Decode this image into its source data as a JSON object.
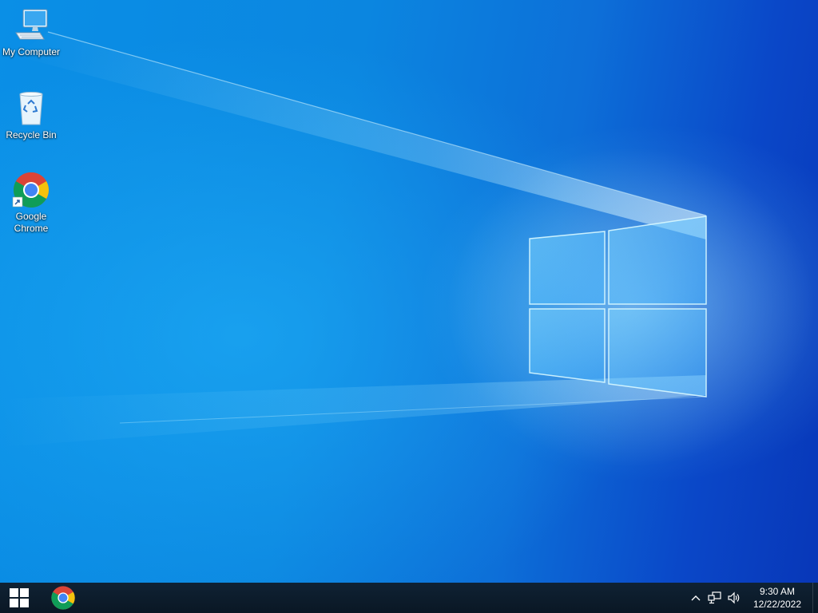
{
  "desktop": {
    "icons": [
      {
        "label": "My Computer",
        "icon": "computer-icon"
      },
      {
        "label": "Recycle Bin",
        "icon": "recycle-bin-icon"
      },
      {
        "label": "Google\nChrome",
        "icon": "chrome-icon"
      }
    ],
    "wallpaper": "windows-10-hero-wallpaper"
  },
  "taskbar": {
    "start_icon": "windows-logo-icon",
    "pinned": [
      {
        "name": "Google Chrome",
        "icon": "chrome-icon"
      }
    ],
    "tray": {
      "icons": [
        "chevron-up-icon",
        "network-icon",
        "volume-icon"
      ],
      "time": "9:30 AM",
      "date": "12/22/2022"
    }
  },
  "colors": {
    "taskbar_bg": "#0f2234",
    "desktop_accent": "#0b86e0",
    "chrome_red": "#db4437",
    "chrome_yellow": "#f4c20d",
    "chrome_green": "#0f9d58",
    "chrome_blue": "#4285f4"
  }
}
